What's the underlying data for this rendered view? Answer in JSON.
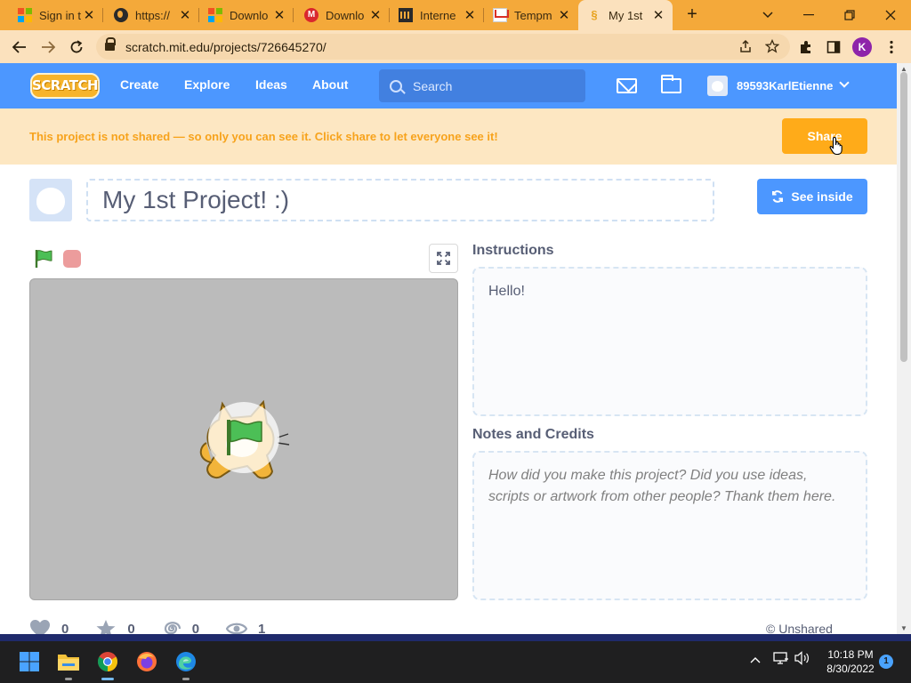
{
  "browser": {
    "tabs": [
      {
        "label": "Sign in t",
        "favicon": "microsoft-icon"
      },
      {
        "label": "https://",
        "favicon": "globe-icon"
      },
      {
        "label": "Downlo",
        "favicon": "microsoft-icon"
      },
      {
        "label": "Downlo",
        "favicon": "mega-icon"
      },
      {
        "label": "Interne",
        "favicon": "museum-icon"
      },
      {
        "label": "Tempm",
        "favicon": "gmail-icon"
      },
      {
        "label": "My 1st",
        "favicon": "scratch-icon"
      }
    ],
    "url": "scratch.mit.edu/projects/726645270/",
    "profile_initial": "K",
    "accent_color": "#f4a93a"
  },
  "scratch_nav": {
    "logo": "SCRATCH",
    "links": [
      "Create",
      "Explore",
      "Ideas",
      "About"
    ],
    "search_placeholder": "Search",
    "username": "89593KarlEtienne",
    "brand_color": "#4c97ff"
  },
  "banner": {
    "message": "This project is not shared — so only you can see it. Click share to let everyone see it!",
    "share_label": "Share"
  },
  "project": {
    "title": "My 1st Project! :)",
    "see_inside_label": "See inside",
    "instructions_heading": "Instructions",
    "instructions_text": "Hello!",
    "notes_heading": "Notes and Credits",
    "notes_placeholder": "How did you make this project? Did you use ideas, scripts or artwork from other people? Thank them here.",
    "stats": {
      "loves": "0",
      "favorites": "0",
      "remixes": "0",
      "views": "1"
    },
    "share_status": "© Unshared"
  },
  "taskbar": {
    "time": "10:18 PM",
    "date": "8/30/2022",
    "notification_count": "1"
  }
}
